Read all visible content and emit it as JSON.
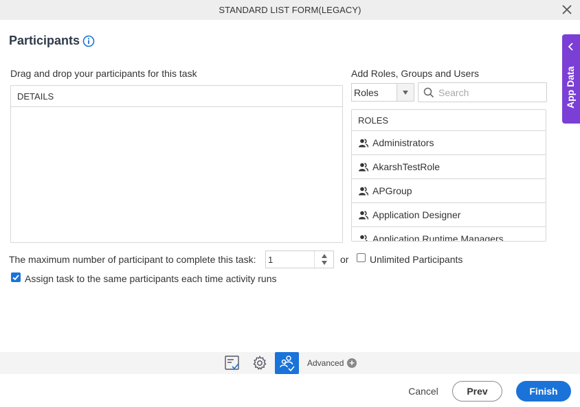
{
  "window": {
    "title": "STANDARD LIST FORM(LEGACY)"
  },
  "page": {
    "heading": "Participants"
  },
  "participants": {
    "drag_label": "Drag and drop your participants for this task",
    "details_header": "DETAILS"
  },
  "picker": {
    "label": "Add Roles, Groups and Users",
    "type_selected": "Roles",
    "search_placeholder": "Search",
    "list_header": "ROLES",
    "items": [
      {
        "label": "Administrators"
      },
      {
        "label": "AkarshTestRole"
      },
      {
        "label": "APGroup"
      },
      {
        "label": "Application Designer"
      },
      {
        "label": "Application Runtime Managers"
      }
    ]
  },
  "completion": {
    "max_label": "The maximum number of participant to complete this task:",
    "max_value": "1",
    "or_label": "or",
    "unlimited_label": "Unlimited Participants",
    "unlimited_checked": false,
    "assign_label": "Assign task to the same participants each time activity runs",
    "assign_checked": true
  },
  "side_panel": {
    "label": "App Data"
  },
  "toolbar": {
    "advanced_label": "Advanced",
    "advanced_plus": "+"
  },
  "footer": {
    "cancel_label": "Cancel",
    "prev_label": "Prev",
    "finish_label": "Finish"
  },
  "colors": {
    "accent": "#1a73d9",
    "app_data": "#7b3fd6",
    "toolbar_bg": "#f4f4f4"
  },
  "icons": [
    "close-icon",
    "info-icon",
    "search-icon",
    "role-icon",
    "chevron-left-icon",
    "form-icon",
    "gear-icon",
    "participants-icon",
    "plus-icon",
    "check-icon"
  ]
}
